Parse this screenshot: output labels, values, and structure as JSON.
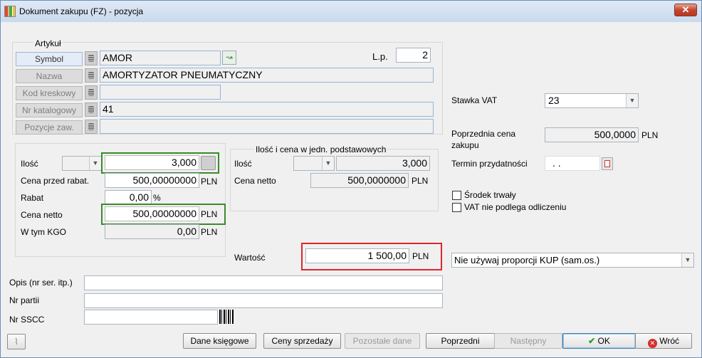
{
  "window": {
    "title": "Dokument zakupu (FZ) - pozycja",
    "close_label": "✕"
  },
  "artykul": {
    "group_label": "Artykuł",
    "symbol_label": "Symbol",
    "symbol_value": "AMOR",
    "nazwa_label": "Nazwa",
    "nazwa_value": "AMORTYZATOR PNEUMATYCZNY",
    "kod_label": "Kod kreskowy",
    "kod_value": "",
    "nrkat_label": "Nr katalogowy",
    "nrkat_value": "41",
    "pozycje_label": "Pozycje zaw.",
    "pozycje_value": "",
    "lp_label": "L.p.",
    "lp_value": "2"
  },
  "left": {
    "ilosc_label": "Ilość",
    "ilosc_unit": "",
    "ilosc_value": "3,000",
    "cena_przed_label": "Cena przed rabat.",
    "cena_przed_value": "500,00000000",
    "cena_przed_currency": "PLN",
    "rabat_label": "Rabat",
    "rabat_value": "0,00",
    "rabat_unit": "%",
    "cena_netto_label": "Cena netto",
    "cena_netto_value": "500,00000000",
    "cena_netto_currency": "PLN",
    "kgo_label": "W tym KGO",
    "kgo_value": "0,00",
    "kgo_currency": "PLN"
  },
  "podst": {
    "group_label": "Ilość i cena w jedn. podstawowych",
    "ilosc_label": "Ilość",
    "ilosc_value": "3,000",
    "cena_netto_label": "Cena netto",
    "cena_netto_value": "500,0000000",
    "cena_netto_currency": "PLN"
  },
  "wartosc": {
    "label": "Wartość",
    "value": "1 500,00",
    "currency": "PLN"
  },
  "right": {
    "vat_label": "Stawka VAT",
    "vat_value": "23",
    "poprz_label_1": "Poprzednia cena",
    "poprz_label_2": "zakupu",
    "poprz_value": "500,0000",
    "poprz_currency": "PLN",
    "termin_label": "Termin przydatności",
    "termin_value": ". .",
    "srodek_label": "Środek trwały",
    "vat_nie_label": "VAT nie podlega odliczeniu",
    "proporcja_value": "Nie używaj proporcji KUP (sam.os.)"
  },
  "bottom_fields": {
    "opis_label": "Opis (nr ser. itp.)",
    "opis_value": "",
    "partia_label": "Nr partii",
    "partia_value": "",
    "sscc_label": "Nr SSCC",
    "sscc_value": ""
  },
  "buttons": {
    "dane_ksiegowe": "Dane księgowe",
    "ceny_sprzedazy": "Ceny sprzedaży",
    "pozostale_dane": "Pozostałe dane",
    "poprzedni": "Poprzedni",
    "nastepny": "Następny",
    "ok": "OK",
    "wroc": "Wróć"
  },
  "colors": {
    "highlight_green": "#3b8a2b",
    "highlight_red": "#e0242a",
    "ok_check": "#2e9b2e",
    "wroc_icon": "#d33030"
  }
}
